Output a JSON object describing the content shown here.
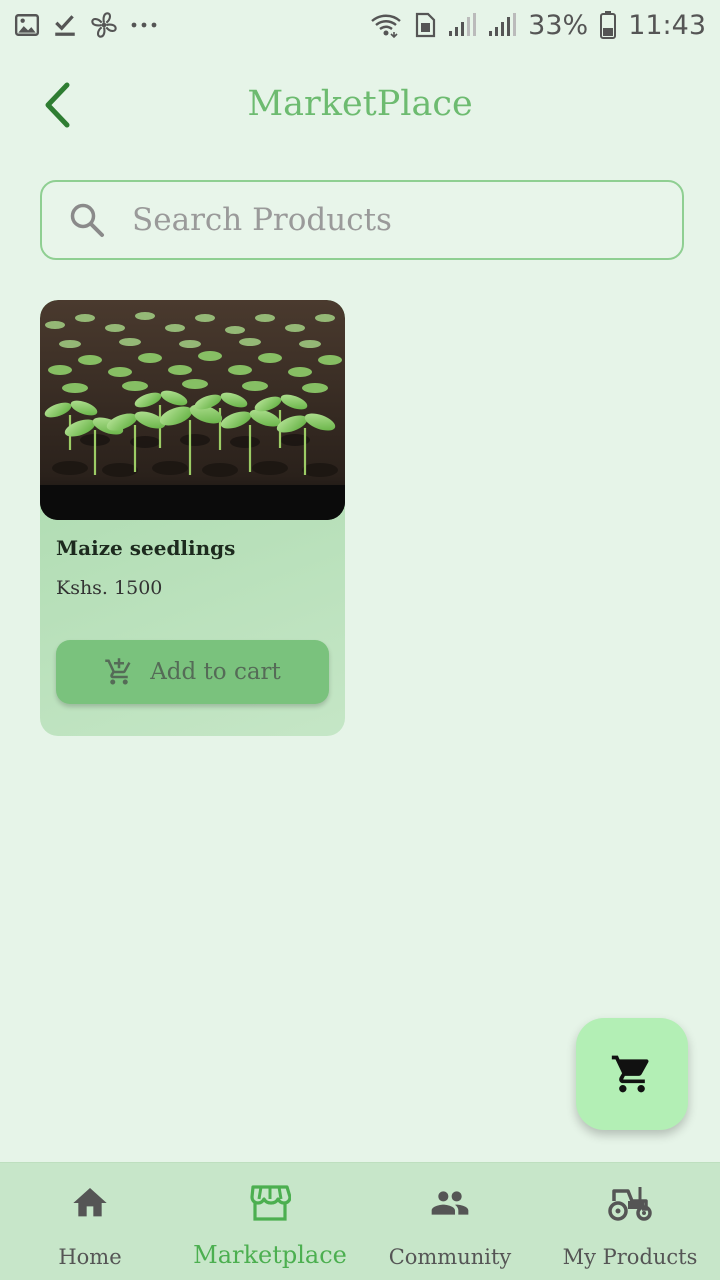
{
  "status_bar": {
    "battery": "33%",
    "time": "11:43",
    "left_icons": [
      "image-icon",
      "check-download-icon",
      "fan-icon",
      "more-dots-icon"
    ],
    "right_icons": [
      "wifi-icon",
      "sim-icon",
      "signal-icon",
      "signal-icon",
      "battery-icon"
    ]
  },
  "header": {
    "title": "MarketPlace",
    "back_icon": "chevron-left-icon"
  },
  "search": {
    "placeholder": "Search Products",
    "value": ""
  },
  "products": [
    {
      "name": "Maize seedlings",
      "price": "Kshs. 1500",
      "button_label": "Add to cart"
    }
  ],
  "fab": {
    "icon": "cart-icon"
  },
  "bottom_nav": {
    "items": [
      {
        "label": "Home",
        "icon": "home-icon",
        "active": false
      },
      {
        "label": "Marketplace",
        "icon": "store-icon",
        "active": true
      },
      {
        "label": "Community",
        "icon": "people-icon",
        "active": false
      },
      {
        "label": "My Products",
        "icon": "tractor-icon",
        "active": false
      }
    ]
  },
  "colors": {
    "background": "#e6f4e8",
    "accent": "#4caf50",
    "title": "#6dbb70",
    "nav_bg": "#c7e6c9",
    "fab_bg": "#b3efb5",
    "button_bg": "#7ac27d"
  }
}
